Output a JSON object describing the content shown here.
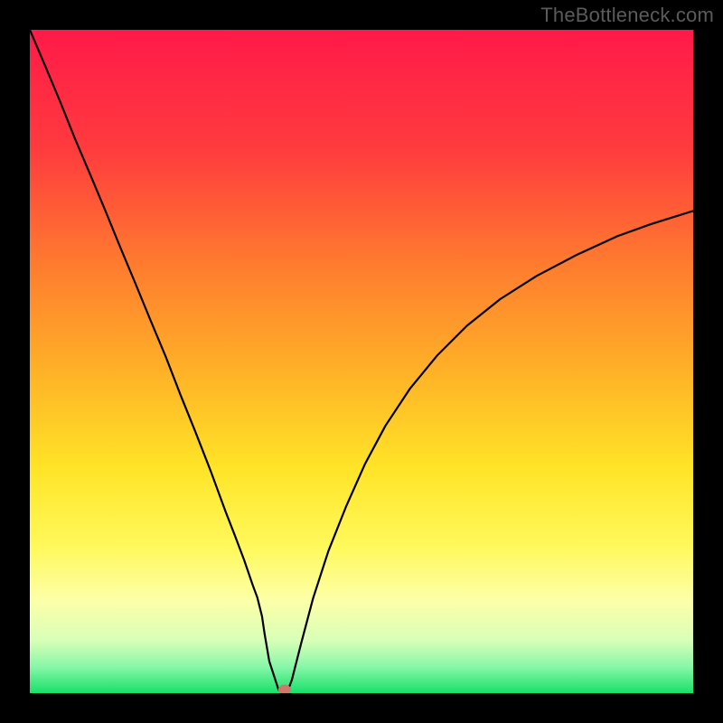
{
  "watermark": "TheBottleneck.com",
  "chart_data": {
    "type": "line",
    "title": "",
    "xlabel": "",
    "ylabel": "",
    "xlim": [
      0,
      100
    ],
    "ylim": [
      0,
      100
    ],
    "gradient_stops": [
      {
        "offset": 0,
        "color": "#ff1a49"
      },
      {
        "offset": 18,
        "color": "#ff3b3e"
      },
      {
        "offset": 35,
        "color": "#ff7a2f"
      },
      {
        "offset": 52,
        "color": "#ffb327"
      },
      {
        "offset": 66,
        "color": "#ffe427"
      },
      {
        "offset": 78,
        "color": "#fff95c"
      },
      {
        "offset": 86,
        "color": "#fdffa8"
      },
      {
        "offset": 92,
        "color": "#d9ffb8"
      },
      {
        "offset": 96,
        "color": "#88f7a8"
      },
      {
        "offset": 100,
        "color": "#18e06a"
      }
    ],
    "series": [
      {
        "name": "bottleneck-curve",
        "color": "#000000",
        "x": [
          0.0,
          2.3,
          4.6,
          6.8,
          9.1,
          11.4,
          13.6,
          15.9,
          18.2,
          20.5,
          22.7,
          25.0,
          27.3,
          29.5,
          30.9,
          32.3,
          33.6,
          34.3,
          35.0,
          35.4,
          36.1,
          37.5,
          38.4,
          38.9,
          39.5,
          40.9,
          42.7,
          45.0,
          47.7,
          50.5,
          53.6,
          57.3,
          61.4,
          65.9,
          70.9,
          76.4,
          82.3,
          88.6,
          93.6,
          100.0
        ],
        "y": [
          100.0,
          94.6,
          89.1,
          83.6,
          78.2,
          72.7,
          67.3,
          61.8,
          56.2,
          50.7,
          45.0,
          39.3,
          33.4,
          27.4,
          23.8,
          20.1,
          16.3,
          14.4,
          11.6,
          8.9,
          4.8,
          0.5,
          0.1,
          0.4,
          2.0,
          7.5,
          14.3,
          21.4,
          28.2,
          34.5,
          40.3,
          45.9,
          50.9,
          55.4,
          59.4,
          62.9,
          66.0,
          68.9,
          70.7,
          72.7
        ]
      }
    ],
    "marker": {
      "x": 38.4,
      "y": 0.5,
      "color": "#c97a69"
    }
  }
}
